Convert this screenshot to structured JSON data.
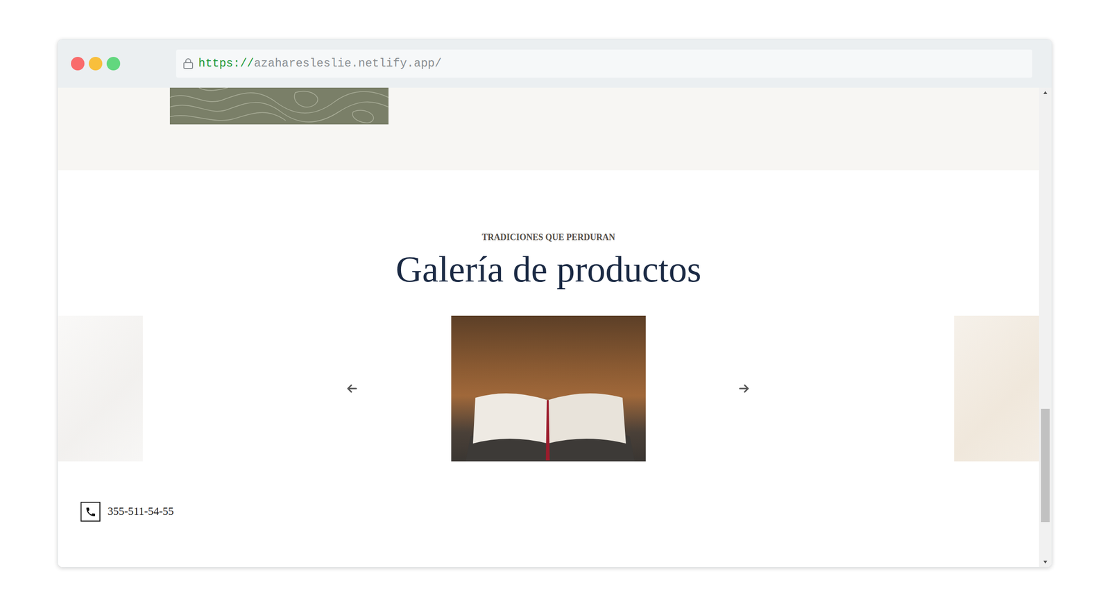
{
  "browser": {
    "url_scheme": "https://",
    "url_host": "azaharesleslie.netlify.app/"
  },
  "gallery": {
    "eyebrow": "TRADICIONES QUE PERDURAN",
    "title": "Galería de productos",
    "slides": [
      {
        "selected": false
      },
      {
        "selected": true
      },
      {
        "selected": false
      }
    ]
  },
  "contact": {
    "phone": "355-511-54-55"
  }
}
